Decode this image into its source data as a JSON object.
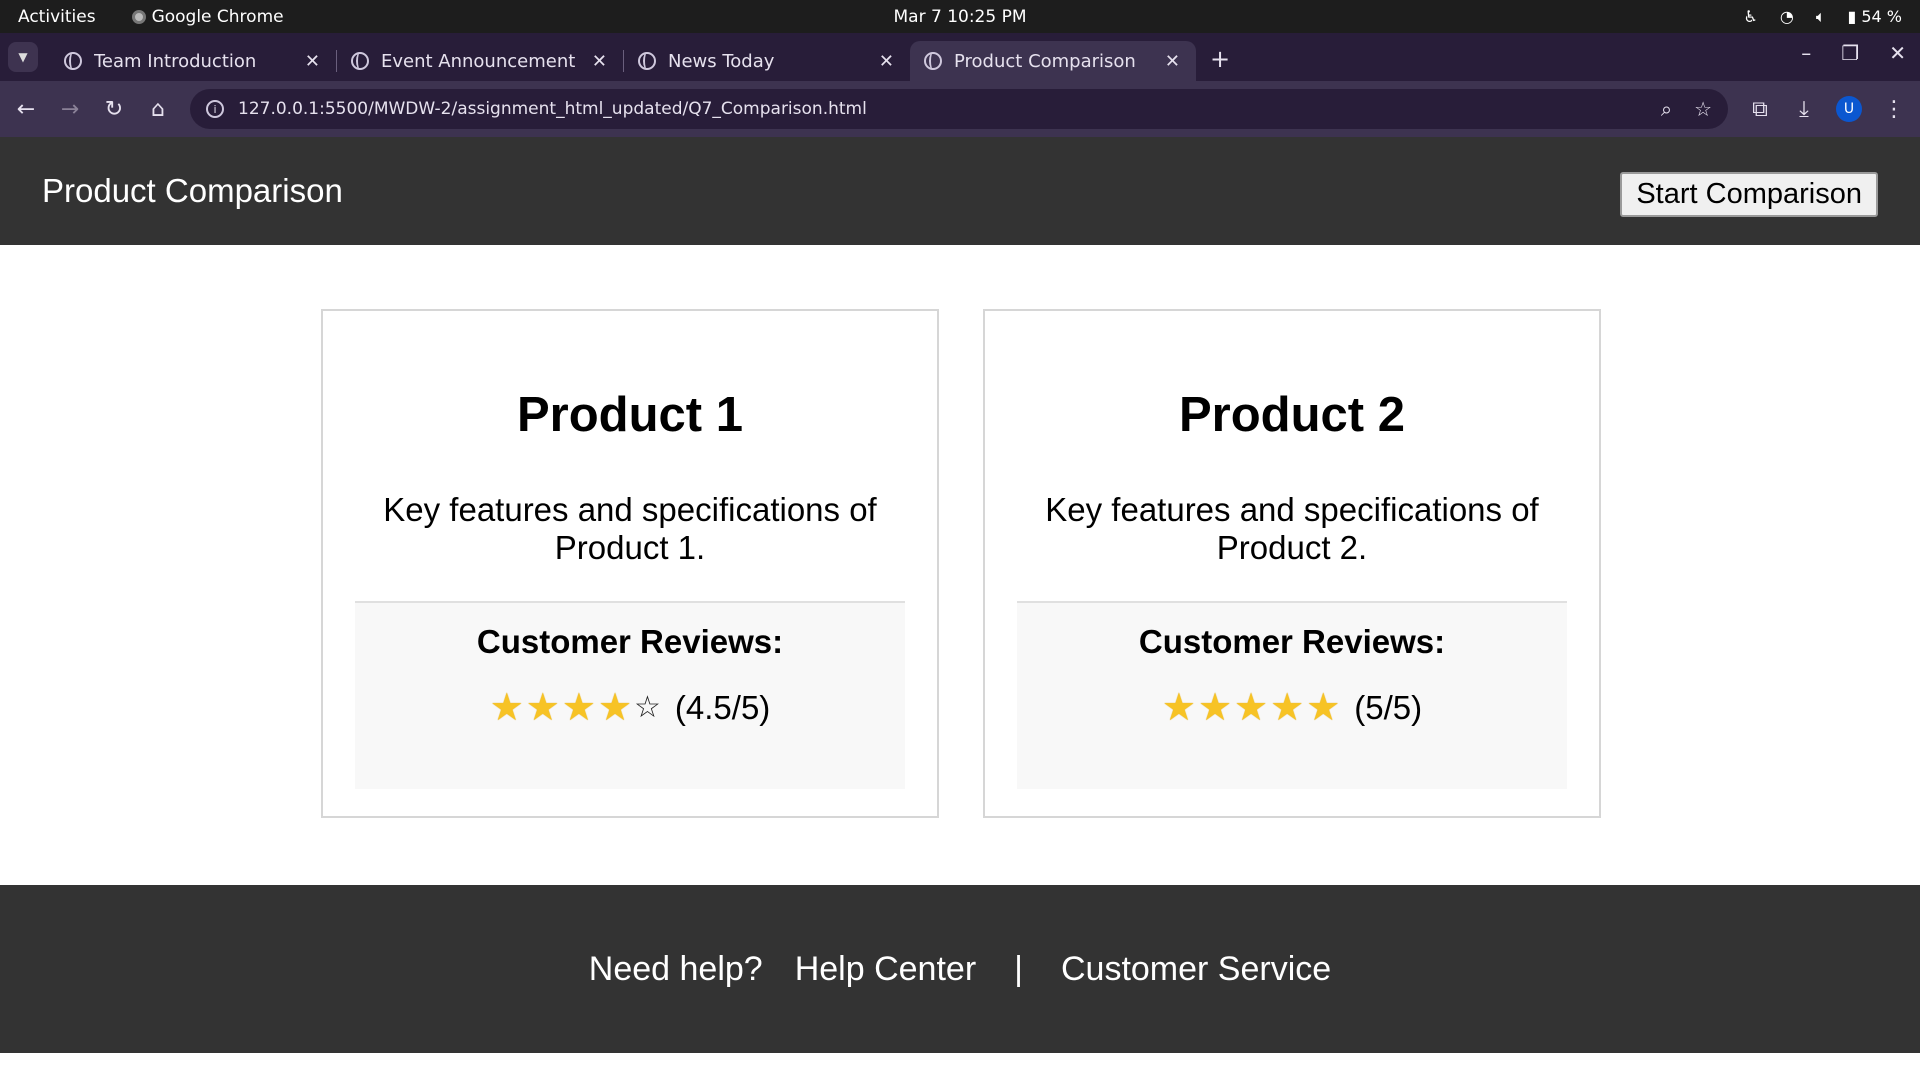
{
  "os": {
    "activities": "Activities",
    "app_name": "Google Chrome",
    "clock": "Mar 7  10:25 PM",
    "battery": "54 %"
  },
  "tabs": [
    {
      "title": "Team Introduction",
      "active": false
    },
    {
      "title": "Event Announcement",
      "active": false
    },
    {
      "title": "News Today",
      "active": false
    },
    {
      "title": "Product Comparison",
      "active": true
    }
  ],
  "address_bar": {
    "url": "127.0.0.1:5500/MWDW-2/assignment_html_updated/Q7_Comparison.html",
    "avatar_letter": "U"
  },
  "header": {
    "title": "Product Comparison",
    "button_label": "Start Comparison"
  },
  "products": [
    {
      "name": "Product 1",
      "description": "Key features and specifications of Product 1.",
      "reviews_heading": "Customer Reviews:",
      "rating_value": 4.5,
      "rating_text": "(4.5/5)"
    },
    {
      "name": "Product 2",
      "description": "Key features and specifications of Product 2.",
      "reviews_heading": "Customer Reviews:",
      "rating_value": 5,
      "rating_text": "(5/5)"
    }
  ],
  "footer": {
    "help_text": "Need help?",
    "help_center": "Help Center",
    "separator": "|",
    "customer_service": "Customer Service"
  },
  "colors": {
    "header_bg": "#333333",
    "star": "#f7c325"
  }
}
